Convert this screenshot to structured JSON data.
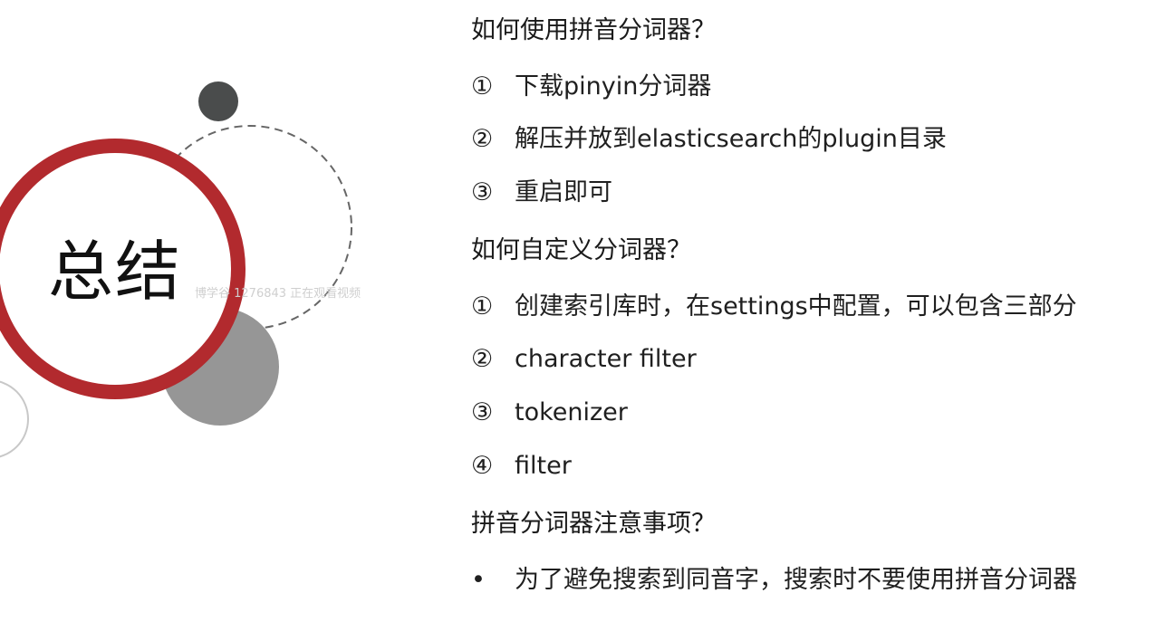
{
  "slide": {
    "title": "总结",
    "watermark": "博学谷 1276843 正在观看视频"
  },
  "sections": [
    {
      "heading": "如何使用拼音分词器？",
      "items": [
        {
          "marker": "①",
          "text": "下载pinyin分词器"
        },
        {
          "marker": "②",
          "text": "解压并放到elasticsearch的plugin目录"
        },
        {
          "marker": "③",
          "text": "重启即可"
        }
      ]
    },
    {
      "heading": "如何自定义分词器？",
      "items": [
        {
          "marker": "①",
          "text": "创建索引库时，在settings中配置，可以包含三部分"
        },
        {
          "marker": "②",
          "text": "character filter"
        },
        {
          "marker": "③",
          "text": "tokenizer"
        },
        {
          "marker": "④",
          "text": "filter"
        }
      ]
    },
    {
      "heading": "拼音分词器注意事项？",
      "items": [
        {
          "marker": "•",
          "text": "为了避免搜索到同音字，搜索时不要使用拼音分词器"
        }
      ]
    }
  ],
  "colors": {
    "ring_red": "#b22a2e",
    "dark_dot": "#4a4c4c",
    "gray_disc": "#969696",
    "dashed_ring": "#666666",
    "thin_ring": "#c8c8c8"
  }
}
